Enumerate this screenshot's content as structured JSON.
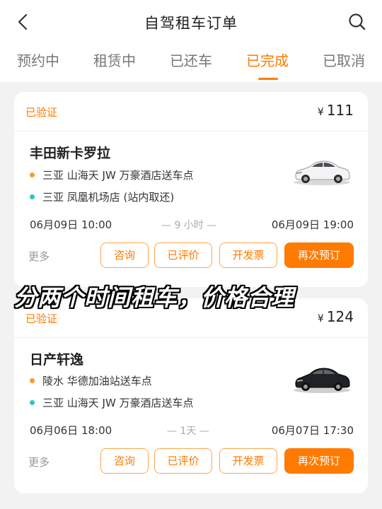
{
  "header": {
    "title": "自驾租车订单"
  },
  "tabs": [
    {
      "label": "预约中"
    },
    {
      "label": "租赁中"
    },
    {
      "label": "已还车"
    },
    {
      "label": "已完成"
    },
    {
      "label": "已取消"
    }
  ],
  "active_tab": "已完成",
  "colors": {
    "accent": "#ff7a00",
    "pickup_dot": "#ff9a1f",
    "return_dot": "#26c6c6"
  },
  "orders": [
    {
      "status": "已验证",
      "currency": "¥",
      "price": "111",
      "car_name": "丰田新卡罗拉",
      "pickup": "三亚 山海天 JW 万豪酒店送车点",
      "return": "三亚 凤凰机场店 (站内取还)",
      "start_time": "06月09日 10:00",
      "duration": "— 9 小时 —",
      "end_time": "06月09日 19:00",
      "car_color": "white",
      "actions": {
        "more": "更多",
        "consult": "咨询",
        "review": "已评价",
        "invoice": "开发票",
        "rebook": "再次预订"
      }
    },
    {
      "status": "已验证",
      "currency": "¥",
      "price": "124",
      "car_name": "日产轩逸",
      "pickup": "陵水 华德加油站送车点",
      "return": "三亚 山海天 JW 万豪酒店送车点",
      "start_time": "06月06日 18:00",
      "duration": "— 1天 —",
      "end_time": "06月07日 17:30",
      "car_color": "black",
      "actions": {
        "more": "更多",
        "consult": "咨询",
        "review": "已评价",
        "invoice": "开发票",
        "rebook": "再次预订"
      }
    }
  ],
  "overlay_caption": "分两个时间租车，价格合理",
  "icons": {
    "back": "chevron-left-icon",
    "search": "search-icon",
    "car": "car-icon"
  }
}
